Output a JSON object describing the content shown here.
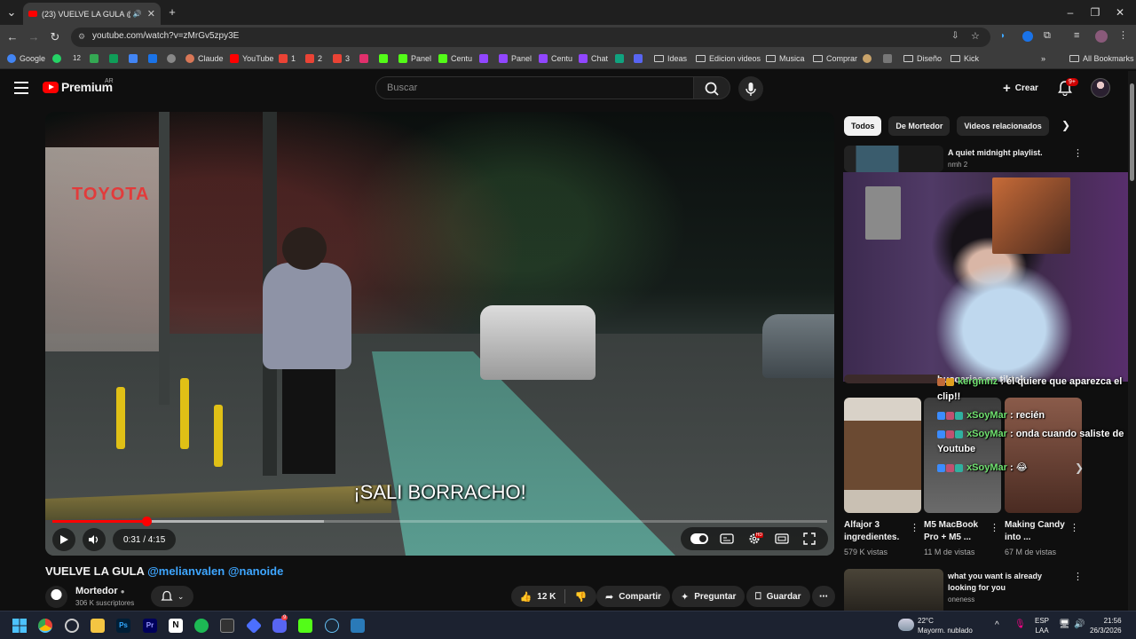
{
  "browser": {
    "tab_title": "(23) VUELVE LA GULA @mel",
    "url": "youtube.com/watch?v=zMrGv5zpy3E",
    "bookmarks": [
      {
        "label": "Google",
        "color": "#4285f4"
      },
      {
        "label": "",
        "color": "#25d366"
      },
      {
        "label": "12",
        "color": ""
      },
      {
        "label": "",
        "color": "#34a853"
      },
      {
        "label": "",
        "color": "#0f9d58"
      },
      {
        "label": "",
        "color": "#4285f4"
      },
      {
        "label": "",
        "color": "#1a73e8"
      },
      {
        "label": "",
        "color": "#888888"
      },
      {
        "label": "Claude",
        "color": "#d97757"
      },
      {
        "label": "YouTube",
        "color": "#ff0000"
      },
      {
        "label": "1",
        "color": "#ea4335"
      },
      {
        "label": "2",
        "color": "#ea4335"
      },
      {
        "label": "3",
        "color": "#ea4335"
      },
      {
        "label": "",
        "color": "#e1306c"
      },
      {
        "label": "",
        "color": "#53fc18"
      },
      {
        "label": "Panel",
        "color": "#53fc18"
      },
      {
        "label": "Centu",
        "color": "#53fc18"
      },
      {
        "label": "",
        "color": "#9146ff"
      },
      {
        "label": "Panel",
        "color": "#9146ff"
      },
      {
        "label": "Centu",
        "color": "#9146ff"
      },
      {
        "label": "Chat",
        "color": "#9146ff"
      },
      {
        "label": "",
        "color": "#10a37f"
      },
      {
        "label": "",
        "color": "#5865f2"
      }
    ],
    "folders": [
      "Ideas",
      "Edicion videos",
      "Musica",
      "Comprar",
      "",
      "Diseño",
      "Kick"
    ],
    "all_bookmarks": "All Bookmarks"
  },
  "youtube": {
    "logo_word": "Premium",
    "country_code": "AR",
    "search_placeholder": "Buscar",
    "create_label": "Crear",
    "notif_count": "9+"
  },
  "player": {
    "subtitle": "¡SALI BORRACHO!",
    "time": "0:31 / 4:15",
    "progress": 0.1216,
    "buffered": 0.35
  },
  "video": {
    "title_main": "VUELVE LA GULA",
    "mention1": "@melianvalen",
    "mention2": "@nanoide",
    "channel_name": "Mortedor",
    "channel_subs": "306 K suscriptores",
    "likes": "12 K",
    "share_label": "Compartir",
    "ask_label": "Preguntar",
    "save_label": "Guardar"
  },
  "chips": [
    "Todos",
    "De Mortedor",
    "Videos relacionados"
  ],
  "recs": [
    {
      "title": "A quiet midnight playlist.",
      "meta": "nmh 2"
    },
    {
      "title": "buscarias en tiktok",
      "meta": ""
    },
    {
      "title": "what you want is already looking for you",
      "meta": "oneness"
    }
  ],
  "chat": [
    {
      "user": "kergmnz",
      "msg": ": él quiere que aparezca el clip!!"
    },
    {
      "user": "xSoyMar",
      "msg": ": recién"
    },
    {
      "user": "xSoyMar",
      "msg": ": onda cuando saliste de Youtube"
    },
    {
      "user": "xSoyMar",
      "msg": ": 😂"
    }
  ],
  "shorts": [
    {
      "title": "Alfajor 3 ingredientes.",
      "views": "579 K vistas"
    },
    {
      "title": "M5 MacBook Pro + M5 ...",
      "views": "11 M de vistas"
    },
    {
      "title": "Making Candy into ...",
      "views": "67 M de vistas"
    }
  ],
  "taskbar": {
    "temp": "22°C",
    "weather": "Mayorm. nublado",
    "lang1": "ESP",
    "lang2": "LAA",
    "time": "21:56",
    "date": "26/3/2026",
    "discord_badge": "9"
  },
  "colors": {
    "accent": "#ff0000",
    "mention": "#3ea6ff",
    "chat_user": "#6fe06f"
  }
}
